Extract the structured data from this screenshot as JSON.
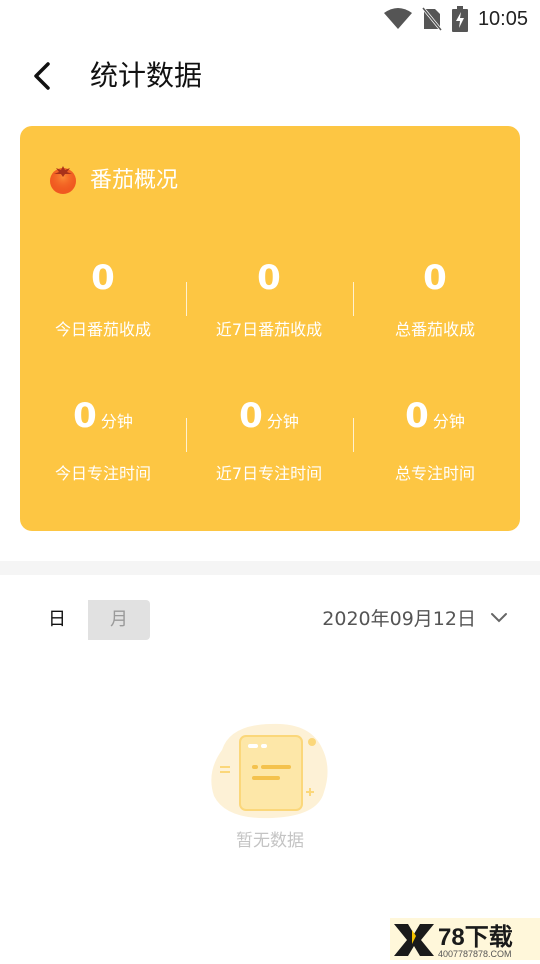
{
  "status_bar": {
    "time": "10:05",
    "icons": [
      "wifi-icon",
      "no-sim-icon",
      "battery-charging-icon"
    ]
  },
  "header": {
    "title": "统计数据",
    "back_icon": "chevron-left-icon"
  },
  "overview": {
    "title": "番茄概况",
    "icon": "tomato-icon",
    "card_color": "#fdc643",
    "today_count": {
      "value": "0",
      "label": "今日番茄收成"
    },
    "week_count": {
      "value": "0",
      "label": "近7日番茄收成"
    },
    "total_count": {
      "value": "0",
      "label": "总番茄收成"
    },
    "today_focus": {
      "value": "0",
      "unit": "分钟",
      "label": "今日专注时间"
    },
    "week_focus": {
      "value": "0",
      "unit": "分钟",
      "label": "近7日专注时间"
    },
    "total_focus": {
      "value": "0",
      "unit": "分钟",
      "label": "总专注时间"
    }
  },
  "filter": {
    "day_label": "日",
    "month_label": "月",
    "selected": "日",
    "date": "2020年09月12日",
    "dropdown_icon": "chevron-down-icon"
  },
  "empty_state": {
    "text": "暂无数据",
    "icon": "empty-document-icon"
  },
  "watermark": {
    "brand": "X78下载",
    "url": "4007787878.COM"
  }
}
